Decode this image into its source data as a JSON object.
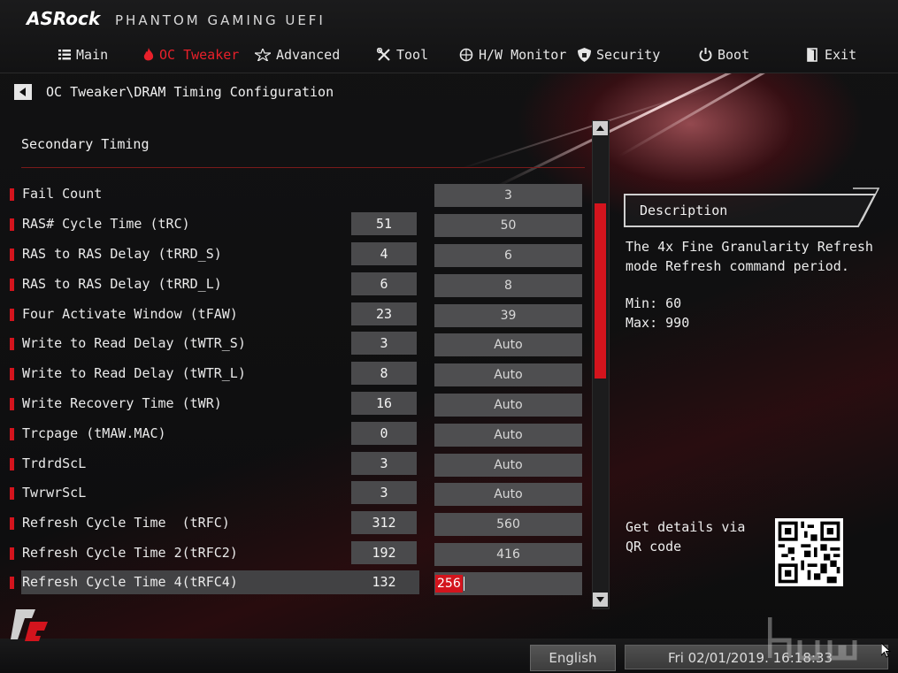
{
  "brand": {
    "name": "ASRock",
    "subtitle": "PHANTOM GAMING UEFI"
  },
  "tabs": [
    {
      "label": "Main",
      "icon": "list-icon",
      "active": false
    },
    {
      "label": "OC Tweaker",
      "icon": "flame-icon",
      "active": true
    },
    {
      "label": "Advanced",
      "icon": "star-icon",
      "active": false
    },
    {
      "label": "Tool",
      "icon": "tools-icon",
      "active": false
    },
    {
      "label": "H/W Monitor",
      "icon": "monitor-icon",
      "active": false
    },
    {
      "label": "Security",
      "icon": "shield-icon",
      "active": false
    },
    {
      "label": "Boot",
      "icon": "power-icon",
      "active": false
    },
    {
      "label": "Exit",
      "icon": "exit-door-icon",
      "active": false
    }
  ],
  "breadcrumb": "OC Tweaker\\DRAM Timing Configuration",
  "section": {
    "title": "Secondary Timing"
  },
  "rows": [
    {
      "label": "Fail Count",
      "current": "",
      "value": "3"
    },
    {
      "label": "RAS# Cycle Time (tRC)",
      "current": "51",
      "value": "50"
    },
    {
      "label": "RAS to RAS Delay (tRRD_S)",
      "current": "4",
      "value": "6"
    },
    {
      "label": "RAS to RAS Delay (tRRD_L)",
      "current": "6",
      "value": "8"
    },
    {
      "label": "Four Activate Window (tFAW)",
      "current": "23",
      "value": "39"
    },
    {
      "label": "Write to Read Delay (tWTR_S)",
      "current": "3",
      "value": "Auto"
    },
    {
      "label": "Write to Read Delay (tWTR_L)",
      "current": "8",
      "value": "Auto"
    },
    {
      "label": "Write Recovery Time (tWR)",
      "current": "16",
      "value": "Auto"
    },
    {
      "label": "Trcpage (tMAW.MAC)",
      "current": "0",
      "value": "Auto"
    },
    {
      "label": "TrdrdScL",
      "current": "3",
      "value": "Auto"
    },
    {
      "label": "TwrwrScL",
      "current": "3",
      "value": "Auto"
    },
    {
      "label": "Refresh Cycle Time  (tRFC)",
      "current": "312",
      "value": "560"
    },
    {
      "label": "Refresh Cycle Time 2(tRFC2)",
      "current": "192",
      "value": "416"
    },
    {
      "label": "Refresh Cycle Time 4(tRFC4)",
      "current": "132",
      "value": "256",
      "selected": true
    }
  ],
  "description": {
    "title": "Description",
    "text": "The 4x Fine Granularity Refresh mode Refresh command period.",
    "min": "Min: 60",
    "max": "Max: 990"
  },
  "qr": {
    "text": "Get details via QR code"
  },
  "footer": {
    "language": "English",
    "datetime": "Fri 02/01/2019. 16:18:33"
  },
  "colors": {
    "accent": "#d3141d",
    "background": "#0b0b0c",
    "field": "#4e4e50"
  }
}
